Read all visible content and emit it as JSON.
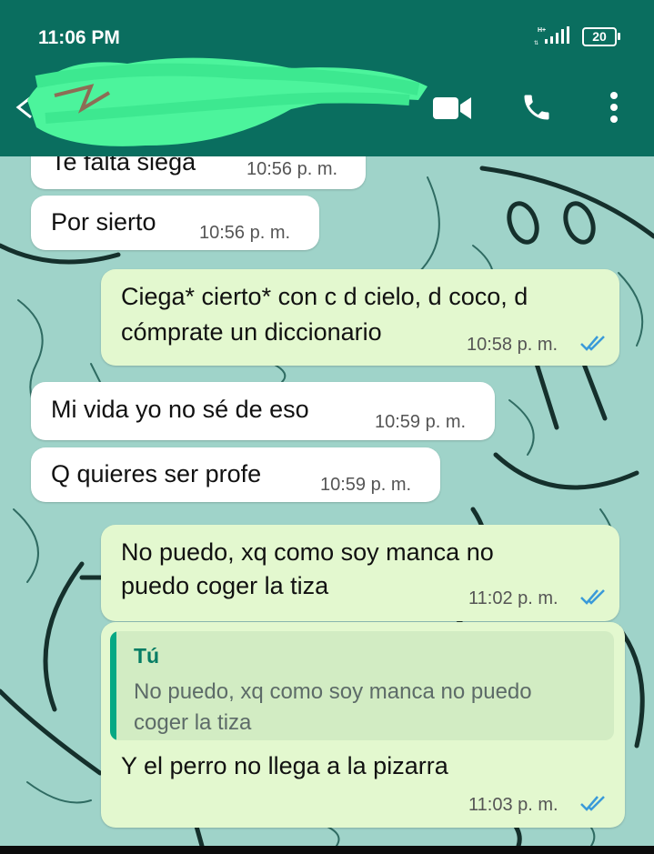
{
  "status_bar": {
    "time": "11:06 PM",
    "network": "H+",
    "battery": "20"
  },
  "chat_header": {
    "contact_name_redacted": true,
    "icons": [
      "back-arrow-icon",
      "video-call-icon",
      "voice-call-icon",
      "more-options-icon"
    ],
    "color": "#0a6e5f"
  },
  "messages": [
    {
      "direction": "incoming",
      "text": "Te falta siega",
      "time": "10:56 p. m."
    },
    {
      "direction": "incoming",
      "text": "Por sierto",
      "time": "10:56 p. m."
    },
    {
      "direction": "outgoing",
      "lines": [
        "Ciega* cierto* con c d cielo, d coco, d",
        "cómprate un diccionario"
      ],
      "time": "10:58 p. m.",
      "status": "read"
    },
    {
      "direction": "incoming",
      "text": "Mi vida yo no sé de eso",
      "time": "10:59 p. m."
    },
    {
      "direction": "incoming",
      "text": "Q quieres ser profe",
      "time": "10:59 p. m."
    },
    {
      "direction": "outgoing",
      "lines": [
        "No puedo, xq como soy manca no",
        "puedo coger la tiza"
      ],
      "time": "11:02 p. m.",
      "status": "read"
    },
    {
      "direction": "outgoing",
      "reply_to": {
        "author": "Tú",
        "lines": [
          "No puedo, xq como soy manca no puedo",
          "coger la tiza"
        ]
      },
      "text": "Y el perro no llega a la pizarra",
      "time": "11:03 p. m.",
      "status": "read"
    }
  ],
  "colors": {
    "incoming_bubble": "#ffffff",
    "outgoing_bubble": "#e3f8cf",
    "wallpaper": "#9fd3c9",
    "read_ticks": "#3a9ad9"
  }
}
